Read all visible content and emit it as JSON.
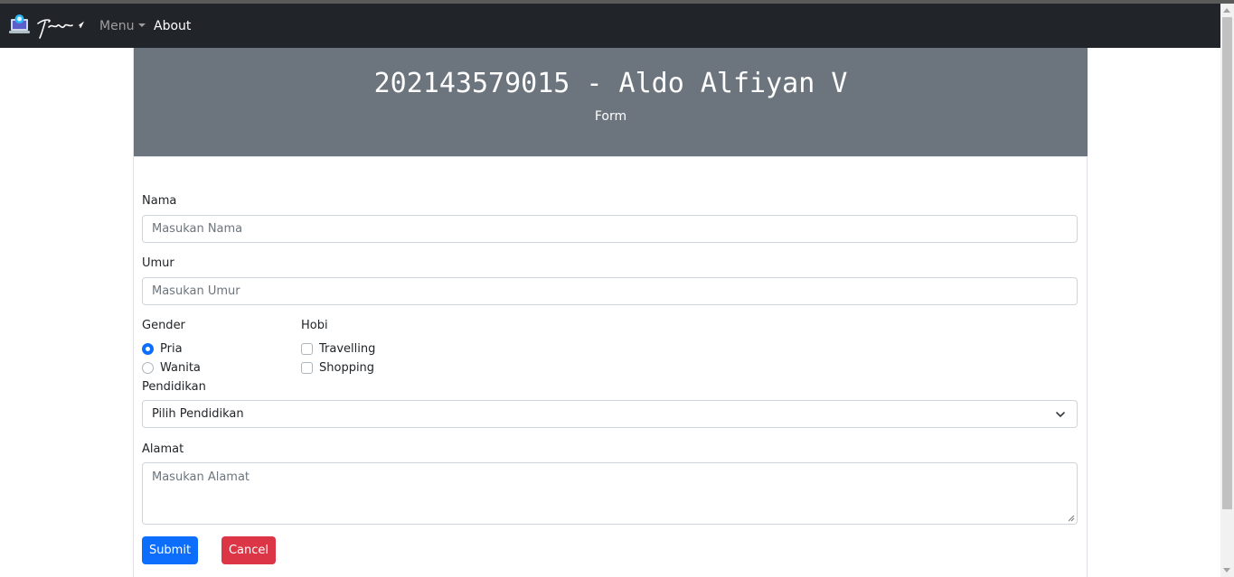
{
  "navbar": {
    "menu_label": "Menu",
    "about_label": "About",
    "brand_icon": "laptop-icon",
    "background": "#212529"
  },
  "header": {
    "title": "202143579015 - Aldo Alfiyan V",
    "subtitle": "Form",
    "background": "#6c757d"
  },
  "form": {
    "nama": {
      "label": "Nama",
      "placeholder": "Masukan Nama"
    },
    "umur": {
      "label": "Umur",
      "placeholder": "Masukan Umur"
    },
    "gender": {
      "label": "Gender",
      "options": [
        {
          "label": "Pria",
          "selected": true
        },
        {
          "label": "Wanita",
          "selected": false
        }
      ]
    },
    "hobi": {
      "label": "Hobi",
      "options": [
        {
          "label": "Travelling",
          "checked": false
        },
        {
          "label": "Shopping",
          "checked": false
        }
      ]
    },
    "pendidikan": {
      "label": "Pendidikan",
      "selected": "Pilih Pendidikan"
    },
    "alamat": {
      "label": "Alamat",
      "placeholder": "Masukan Alamat"
    },
    "submit_label": "Submit",
    "cancel_label": "Cancel"
  },
  "colors": {
    "primary": "#0d6efd",
    "danger": "#dc3545"
  }
}
